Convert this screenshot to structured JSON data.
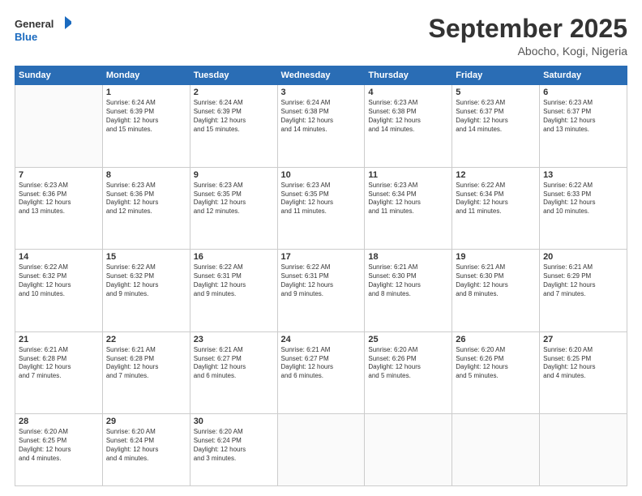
{
  "header": {
    "logo_general": "General",
    "logo_blue": "Blue",
    "month": "September 2025",
    "location": "Abocho, Kogi, Nigeria"
  },
  "weekdays": [
    "Sunday",
    "Monday",
    "Tuesday",
    "Wednesday",
    "Thursday",
    "Friday",
    "Saturday"
  ],
  "weeks": [
    [
      {
        "day": "",
        "info": ""
      },
      {
        "day": "1",
        "info": "Sunrise: 6:24 AM\nSunset: 6:39 PM\nDaylight: 12 hours\nand 15 minutes."
      },
      {
        "day": "2",
        "info": "Sunrise: 6:24 AM\nSunset: 6:39 PM\nDaylight: 12 hours\nand 15 minutes."
      },
      {
        "day": "3",
        "info": "Sunrise: 6:24 AM\nSunset: 6:38 PM\nDaylight: 12 hours\nand 14 minutes."
      },
      {
        "day": "4",
        "info": "Sunrise: 6:23 AM\nSunset: 6:38 PM\nDaylight: 12 hours\nand 14 minutes."
      },
      {
        "day": "5",
        "info": "Sunrise: 6:23 AM\nSunset: 6:37 PM\nDaylight: 12 hours\nand 14 minutes."
      },
      {
        "day": "6",
        "info": "Sunrise: 6:23 AM\nSunset: 6:37 PM\nDaylight: 12 hours\nand 13 minutes."
      }
    ],
    [
      {
        "day": "7",
        "info": "Sunrise: 6:23 AM\nSunset: 6:36 PM\nDaylight: 12 hours\nand 13 minutes."
      },
      {
        "day": "8",
        "info": "Sunrise: 6:23 AM\nSunset: 6:36 PM\nDaylight: 12 hours\nand 12 minutes."
      },
      {
        "day": "9",
        "info": "Sunrise: 6:23 AM\nSunset: 6:35 PM\nDaylight: 12 hours\nand 12 minutes."
      },
      {
        "day": "10",
        "info": "Sunrise: 6:23 AM\nSunset: 6:35 PM\nDaylight: 12 hours\nand 11 minutes."
      },
      {
        "day": "11",
        "info": "Sunrise: 6:23 AM\nSunset: 6:34 PM\nDaylight: 12 hours\nand 11 minutes."
      },
      {
        "day": "12",
        "info": "Sunrise: 6:22 AM\nSunset: 6:34 PM\nDaylight: 12 hours\nand 11 minutes."
      },
      {
        "day": "13",
        "info": "Sunrise: 6:22 AM\nSunset: 6:33 PM\nDaylight: 12 hours\nand 10 minutes."
      }
    ],
    [
      {
        "day": "14",
        "info": "Sunrise: 6:22 AM\nSunset: 6:32 PM\nDaylight: 12 hours\nand 10 minutes."
      },
      {
        "day": "15",
        "info": "Sunrise: 6:22 AM\nSunset: 6:32 PM\nDaylight: 12 hours\nand 9 minutes."
      },
      {
        "day": "16",
        "info": "Sunrise: 6:22 AM\nSunset: 6:31 PM\nDaylight: 12 hours\nand 9 minutes."
      },
      {
        "day": "17",
        "info": "Sunrise: 6:22 AM\nSunset: 6:31 PM\nDaylight: 12 hours\nand 9 minutes."
      },
      {
        "day": "18",
        "info": "Sunrise: 6:21 AM\nSunset: 6:30 PM\nDaylight: 12 hours\nand 8 minutes."
      },
      {
        "day": "19",
        "info": "Sunrise: 6:21 AM\nSunset: 6:30 PM\nDaylight: 12 hours\nand 8 minutes."
      },
      {
        "day": "20",
        "info": "Sunrise: 6:21 AM\nSunset: 6:29 PM\nDaylight: 12 hours\nand 7 minutes."
      }
    ],
    [
      {
        "day": "21",
        "info": "Sunrise: 6:21 AM\nSunset: 6:28 PM\nDaylight: 12 hours\nand 7 minutes."
      },
      {
        "day": "22",
        "info": "Sunrise: 6:21 AM\nSunset: 6:28 PM\nDaylight: 12 hours\nand 7 minutes."
      },
      {
        "day": "23",
        "info": "Sunrise: 6:21 AM\nSunset: 6:27 PM\nDaylight: 12 hours\nand 6 minutes."
      },
      {
        "day": "24",
        "info": "Sunrise: 6:21 AM\nSunset: 6:27 PM\nDaylight: 12 hours\nand 6 minutes."
      },
      {
        "day": "25",
        "info": "Sunrise: 6:20 AM\nSunset: 6:26 PM\nDaylight: 12 hours\nand 5 minutes."
      },
      {
        "day": "26",
        "info": "Sunrise: 6:20 AM\nSunset: 6:26 PM\nDaylight: 12 hours\nand 5 minutes."
      },
      {
        "day": "27",
        "info": "Sunrise: 6:20 AM\nSunset: 6:25 PM\nDaylight: 12 hours\nand 4 minutes."
      }
    ],
    [
      {
        "day": "28",
        "info": "Sunrise: 6:20 AM\nSunset: 6:25 PM\nDaylight: 12 hours\nand 4 minutes."
      },
      {
        "day": "29",
        "info": "Sunrise: 6:20 AM\nSunset: 6:24 PM\nDaylight: 12 hours\nand 4 minutes."
      },
      {
        "day": "30",
        "info": "Sunrise: 6:20 AM\nSunset: 6:24 PM\nDaylight: 12 hours\nand 3 minutes."
      },
      {
        "day": "",
        "info": ""
      },
      {
        "day": "",
        "info": ""
      },
      {
        "day": "",
        "info": ""
      },
      {
        "day": "",
        "info": ""
      }
    ]
  ]
}
